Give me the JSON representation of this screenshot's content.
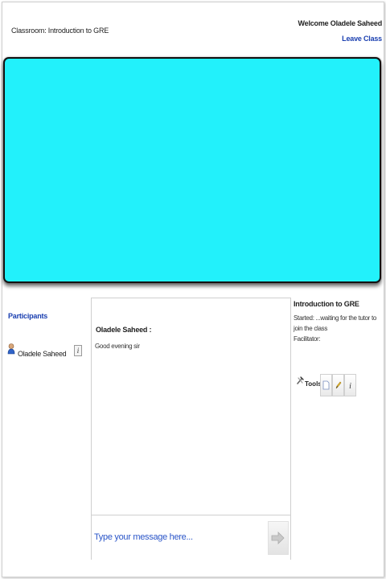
{
  "header": {
    "classroom_title": "Classroom: Introduction to GRE",
    "welcome_text": "Welcome Oladele Saheed",
    "leave_link": "Leave Class"
  },
  "stage": {
    "background_color": "#22f1fb"
  },
  "participants": {
    "title": "Participants",
    "items": [
      {
        "name": "Oladele Saheed",
        "icon": "user-icon",
        "info_icon": "info-icon"
      }
    ]
  },
  "chat": {
    "messages": [
      {
        "sender": "Oladele Saheed :",
        "text": "Good evening sir"
      }
    ],
    "input_placeholder": "Type your message here...",
    "send_icon": "send-arrow-icon"
  },
  "class_info": {
    "course_title": "Introduction to GRE",
    "started_text": "Started: ...waiting for the tutor to join the class",
    "facilitator_text": "Facilitator:",
    "tools_label": "Tools:",
    "tool_icons": [
      "document-icon",
      "pencil-icon",
      "info-icon"
    ]
  },
  "colors": {
    "link_blue": "#1a3fb0",
    "stage_cyan": "#22f1fb"
  }
}
